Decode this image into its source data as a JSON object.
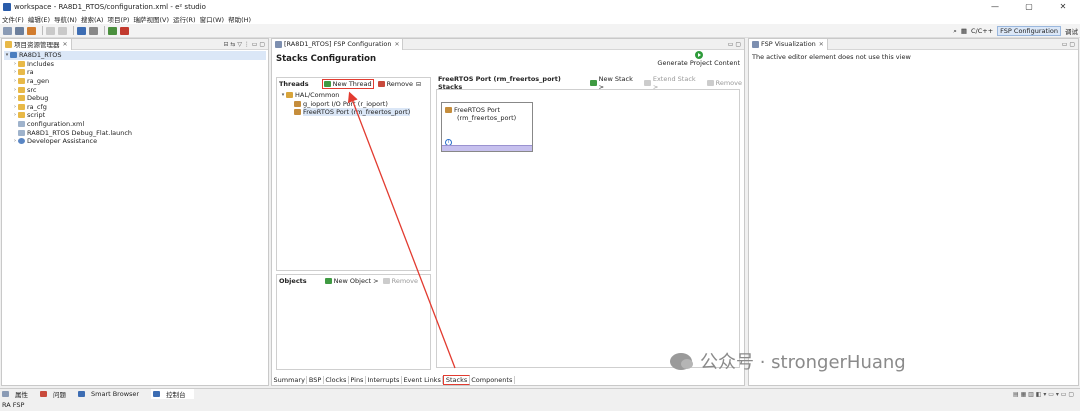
{
  "window": {
    "title": "workspace - RA8D1_RTOS/configuration.xml - e² studio",
    "controls": [
      "—",
      "▢",
      "✕"
    ]
  },
  "menu": [
    "文件(F)",
    "编辑(E)",
    "导航(N)",
    "搜索(A)",
    "项目(P)",
    "瑞萨视图(V)",
    "运行(R)",
    "窗口(W)",
    "帮助(H)"
  ],
  "perspectives": {
    "cc": "C/C++",
    "fsp": "FSP Configuration",
    "debug": "调试"
  },
  "project_explorer": {
    "tab_label": "项目资源管理器",
    "items": [
      {
        "label": "RA8D1_RTOS",
        "twisty": "▾",
        "kind": "proj"
      },
      {
        "label": "Includes",
        "twisty": "›",
        "kind": "folder"
      },
      {
        "label": "ra",
        "twisty": "›",
        "kind": "folder"
      },
      {
        "label": "ra_gen",
        "twisty": "›",
        "kind": "folder"
      },
      {
        "label": "src",
        "twisty": "›",
        "kind": "folder"
      },
      {
        "label": "Debug",
        "twisty": "›",
        "kind": "folder"
      },
      {
        "label": "ra_cfg",
        "twisty": "›",
        "kind": "folder"
      },
      {
        "label": "script",
        "twisty": "›",
        "kind": "folder"
      },
      {
        "label": "configuration.xml",
        "twisty": "",
        "kind": "file"
      },
      {
        "label": "RA8D1_RTOS Debug_Flat.launch",
        "twisty": "",
        "kind": "file"
      },
      {
        "label": "Developer Assistance",
        "twisty": "›",
        "kind": "help"
      }
    ]
  },
  "fsp_config": {
    "tab_label": "[RA8D1_RTOS] FSP Configuration",
    "title": "Stacks Configuration",
    "generate_label": "Generate Project Content",
    "threads": {
      "header": "Threads",
      "new_thread": "New Thread",
      "remove": "Remove",
      "tree": [
        {
          "label": "HAL/Common",
          "twisty": "▾",
          "selected": false
        },
        {
          "label": "g_ioport I/O Port (r_ioport)",
          "twisty": "",
          "selected": false
        },
        {
          "label": "FreeRTOS Port (rm_freertos_port)",
          "twisty": "",
          "selected": true
        }
      ]
    },
    "objects": {
      "header": "Objects",
      "new_object": "New Object >",
      "remove": "Remove"
    },
    "stacks": {
      "header": "FreeRTOS Port (rm_freertos_port) Stacks",
      "new_stack": "New Stack >",
      "extend_stack": "Extend Stack >",
      "remove": "Remove",
      "block_line1": "FreeRTOS Port",
      "block_line2": "(rm_freertos_port)",
      "info_glyph": "i"
    },
    "bottom_tabs": [
      "Summary",
      "BSP",
      "Clocks",
      "Pins",
      "Interrupts",
      "Event Links",
      "Stacks",
      "Components"
    ],
    "active_bottom_tab": "Stacks"
  },
  "fsp_visualization": {
    "tab_label": "FSP Visualization",
    "message": "The active editor element does not use this view"
  },
  "console_tabs": [
    "属性",
    "问题",
    "Smart Browser",
    "控制台"
  ],
  "status_text": "RA FSP",
  "watermark_text": "公众号 · strongerHuang",
  "colors": {
    "highlight": "#e23b30",
    "selection": "#dbe7f7",
    "stack_strip": "#c6c0ee"
  }
}
